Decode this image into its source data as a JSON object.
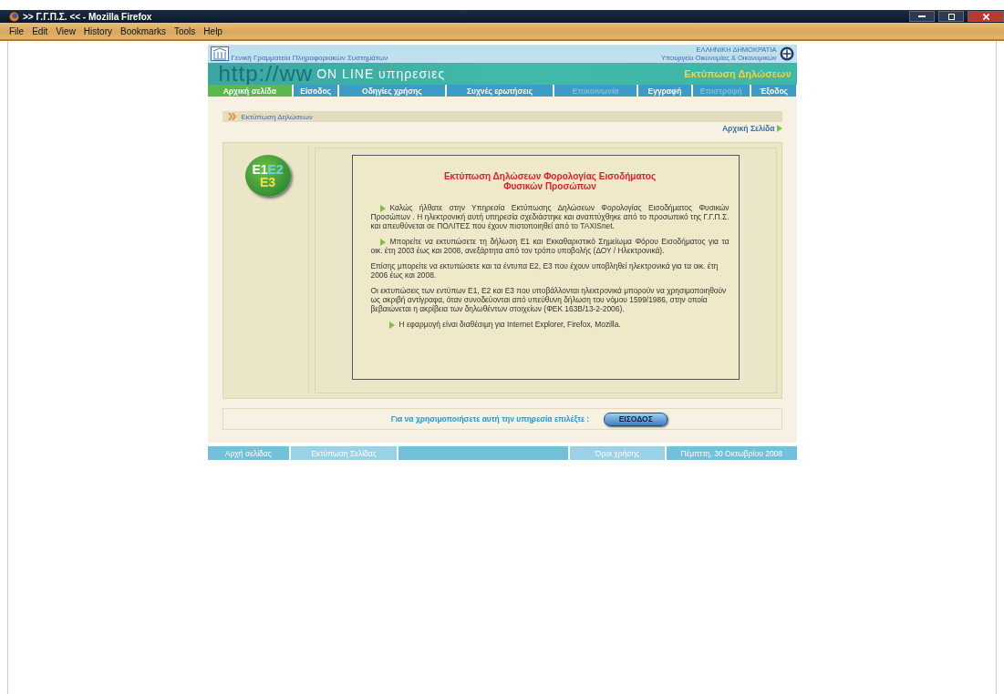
{
  "window": {
    "title": ">> Γ.Γ.Π.Σ. << - Mozilla Firefox"
  },
  "menu": [
    "File",
    "Edit",
    "View",
    "History",
    "Bookmarks",
    "Tools",
    "Help"
  ],
  "header": {
    "org": "Γενική Γραμματεία Πληροφοριακών Συστημάτων",
    "country": "ΕΛΛΗΝΙΚΗ ΔΗΜΟΚΡΑΤΙΑ",
    "ministry": "Υπουργείο Οικονομίας & Οικονομικών"
  },
  "banner": {
    "url": "http://ww",
    "service": "ON LINE υπηρεσιες",
    "page_title": "Εκτύπωση Δηλώσεων"
  },
  "nav": [
    {
      "label": "Αρχική σελίδα",
      "selected": true,
      "disabled": false
    },
    {
      "label": "Είσοδος",
      "selected": false,
      "disabled": false
    },
    {
      "label": "Οδηγίες χρήσης",
      "selected": false,
      "disabled": false
    },
    {
      "label": "Συχνές ερωτήσεις",
      "selected": false,
      "disabled": false
    },
    {
      "label": "Επικοινωνία",
      "selected": false,
      "disabled": true
    },
    {
      "label": "Εγγραφή",
      "selected": false,
      "disabled": false
    },
    {
      "label": "Επιστροφή",
      "selected": false,
      "disabled": true
    },
    {
      "label": "Έξοδος",
      "selected": false,
      "disabled": false
    }
  ],
  "breadcrumb": {
    "label": "Εκτύπωση Δηλώσεων",
    "home_link": "Αρχική Σελίδα"
  },
  "badge": [
    "E1",
    "E2",
    "E3"
  ],
  "article": {
    "title": [
      "Εκτύπωση Δηλώσεων Φορολογίας Εισοδήματος",
      "Φυσικών Προσώπων"
    ],
    "paragraphs": [
      {
        "kind": "bullet",
        "text": "Καλώς ήλθατε στην Υπηρεσία Εκτύπωσης Δηλώσεων Φορολογίας Εισοδήματος Φυσικών Προσώπων . Η ηλεκτρονική αυτή υπηρεσία σχεδιάστηκε και αναπτύχθηκε από το προσωπικό της Γ.Γ.Π.Σ. και απευθύνεται σε ΠΟΛΙΤΕΣ που έχουν πιστοποιηθεί από το TAXISnet."
      },
      {
        "kind": "bullet",
        "text": "Μπορείτε να εκτυπώσετε τη δήλωση Ε1 και Εκκαθαριστικό Σημείωμα Φόρου Εισοδήματος για τα οικ. έτη 2003 έως και 2008, ανεξάρτητα από τον τρόπο υποβολής (ΔΟΥ / Ηλεκτρονικά)."
      },
      {
        "kind": "plain",
        "text": "Επίσης μπορείτε να εκτυπώσετε και τα έντυπα Ε2, Ε3 που έχουν υποβληθεί ηλεκτρονικά για τα οικ. έτη 2006 έως και 2008."
      },
      {
        "kind": "plain",
        "text": "Οι εκτυπώσεις των εντύπων Ε1, Ε2 και Ε3 που υποβάλλονται ηλεκτρονικά μπορούν να χρησιμοποιηθούν ως ακριβή αντίγραφα, όταν συνοδεύονται από υπεύθυνη δήλωση του νόμου 1599/1986, στην οποία βεβαιώνεται η ακρίβεια των δηλωθέντων στοιχείων (ΦΕΚ 163Β/13-2-2006)."
      },
      {
        "kind": "indented",
        "text": "Η εφαρμογή είναι διαθέσιμη για Internet Explorer, Firefox, Mozilla."
      }
    ]
  },
  "action": {
    "prompt": "Για να χρησιμοποιήσετε αυτή την υπηρεσία επιλέξτε :",
    "button": "ΕΙΣΟΔΟΣ"
  },
  "footer": [
    {
      "kind": "dark",
      "label": "Αρχή σελίδας"
    },
    {
      "kind": "light",
      "label": "Εκτύπωση Σελίδας"
    },
    {
      "kind": "spacer"
    },
    {
      "kind": "light",
      "label": "Όροι χρήσης"
    },
    {
      "kind": "dark",
      "label": "Πέμπττη, 30 Οκτωβρίου 2008"
    }
  ]
}
